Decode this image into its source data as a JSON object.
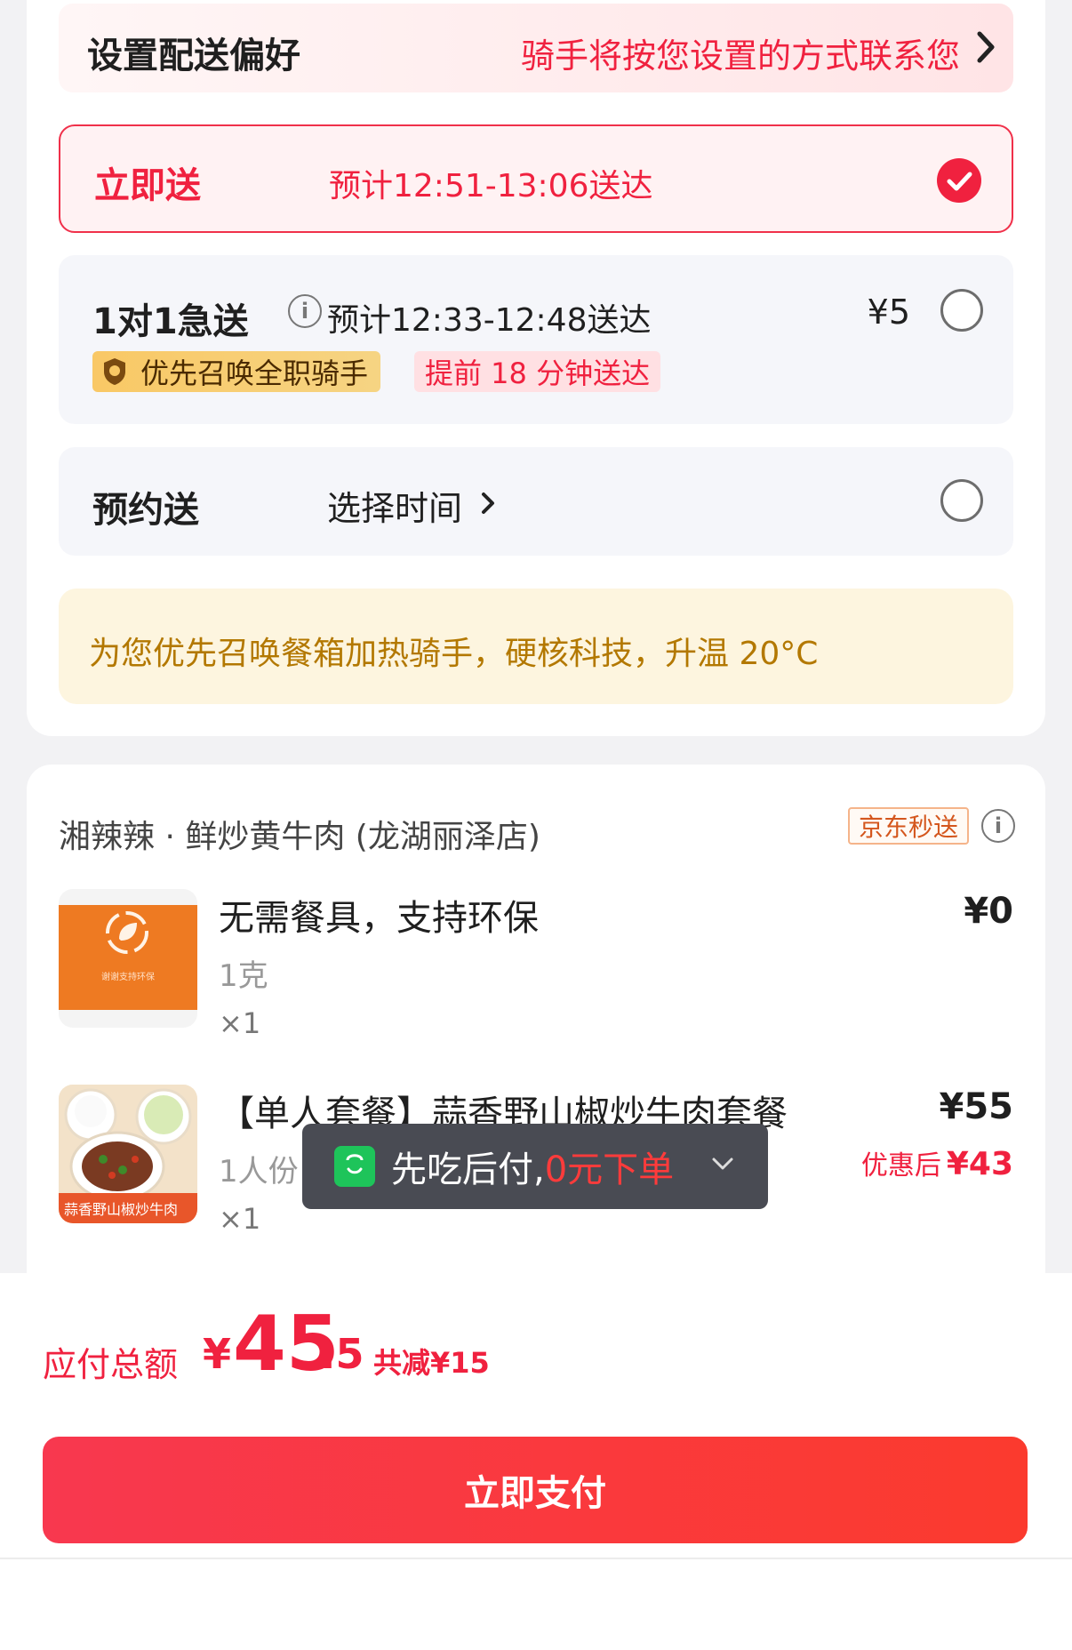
{
  "delivery": {
    "preference_label": "设置配送偏好",
    "preference_hint": "骑手将按您设置的方式联系您",
    "options": {
      "now": {
        "title": "立即送",
        "eta": "预计12:51-13:06送达",
        "selected": true
      },
      "fast": {
        "title": "1对1急送",
        "eta": "预计12:33-12:48送达",
        "price": "¥5",
        "badge_gold": "优先召唤全职骑手",
        "badge_pink": "提前 18 分钟送达",
        "selected": false
      },
      "scheduled": {
        "title": "预约送",
        "pick_label": "选择时间",
        "selected": false
      }
    },
    "heat_notice": "为您优先召唤餐箱加热骑手，硬核科技，升温 20°C"
  },
  "store": {
    "name": "湘辣辣 · 鲜炒黄牛肉 (龙湖丽泽店)",
    "tag": "京东秒送",
    "items": [
      {
        "name": "无需餐具，支持环保",
        "spec": "1克",
        "qty": "×1",
        "price": "¥0",
        "thumb_caption": "谢谢支持环保"
      },
      {
        "name": "【单人套餐】蒜香野山椒炒牛肉套餐",
        "spec": "1人份",
        "qty": "×1",
        "price": "¥55",
        "discount_label": "优惠后",
        "discount_price": "¥43",
        "thumb_caption": "蒜香野山椒炒牛肉"
      }
    ]
  },
  "toast": {
    "text_prefix": "先吃后付,",
    "text_highlight": "0元下单"
  },
  "footer": {
    "total_label": "应付总额",
    "currency": "¥",
    "total_int": "45",
    "total_dec": ".5",
    "saved": "共减¥15",
    "pay_button": "立即支付"
  },
  "colors": {
    "accent": "#f0213f",
    "gold": "#f9c865",
    "notice_text": "#b37800"
  }
}
